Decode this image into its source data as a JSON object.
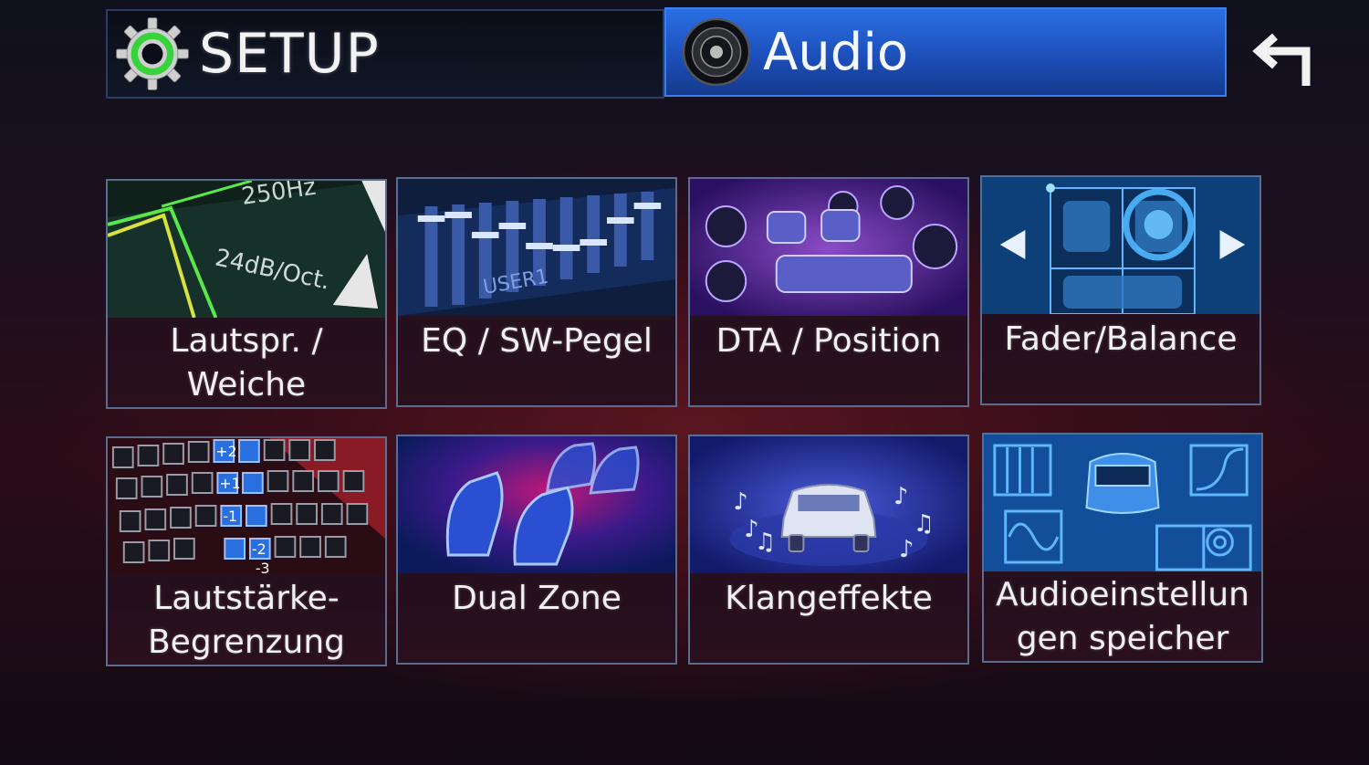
{
  "header": {
    "setup_label": "SETUP",
    "audio_label": "Audio",
    "icons": [
      "gear-icon",
      "speaker-icon",
      "back-arrow-icon"
    ],
    "colors": {
      "header_active": "#1d4fba",
      "gear_ring": "#3cd63c"
    }
  },
  "tiles": [
    {
      "label": "Lautspr. / Weiche",
      "icon": "crossover-graph-icon",
      "art_text": [
        "250Hz",
        "24dB/Oct."
      ]
    },
    {
      "label": "EQ / SW-Pegel",
      "icon": "equalizer-sliders-icon",
      "art_text": [
        "USER1"
      ]
    },
    {
      "label": "DTA / Position",
      "icon": "speakers-seats-icon"
    },
    {
      "label": "Fader/Balance",
      "icon": "fader-balance-grid-icon"
    },
    {
      "label": "Lautstärke-Begrenzung",
      "icon": "volume-limit-keys-icon",
      "art_text": [
        "+2",
        "+1",
        "-1",
        "-2",
        "-3"
      ]
    },
    {
      "label": "Dual Zone",
      "icon": "dual-zone-seats-icon"
    },
    {
      "label": "Klangeffekte",
      "icon": "car-music-notes-icon"
    },
    {
      "label": "Audioeinstellungen speicher",
      "icon": "audio-settings-memory-icon"
    }
  ]
}
